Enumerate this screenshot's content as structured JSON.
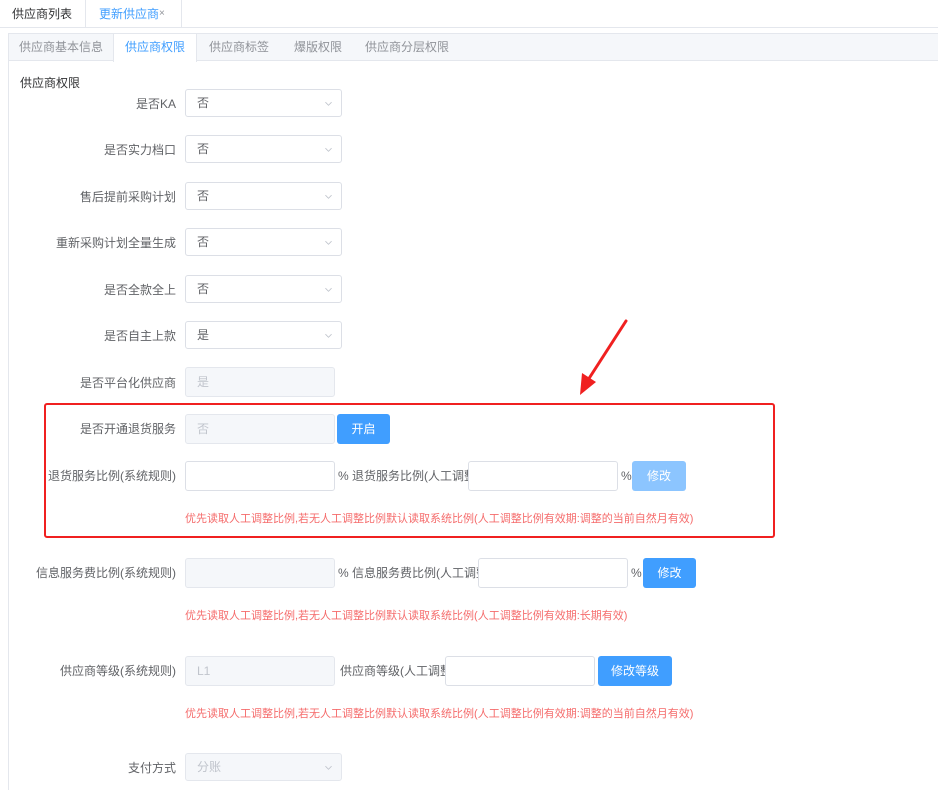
{
  "top_tabs": [
    {
      "label": "供应商列表"
    },
    {
      "label": "更新供应商",
      "close": "×"
    }
  ],
  "sub_tabs": [
    {
      "label": "供应商基本信息"
    },
    {
      "label": "供应商权限"
    },
    {
      "label": "供应商标签"
    },
    {
      "label": "爆版权限"
    },
    {
      "label": "供应商分层权限"
    }
  ],
  "section_title": "供应商权限",
  "fields": {
    "is_ka": {
      "label": "是否KA",
      "value": "否"
    },
    "is_strong_stall": {
      "label": "是否实力档口",
      "value": "否"
    },
    "after_sale_plan": {
      "label": "售后提前采购计划",
      "value": "否"
    },
    "regen_plan": {
      "label": "重新采购计划全量生成",
      "value": "否"
    },
    "full_payment": {
      "label": "是否全款全上",
      "value": "否"
    },
    "self_listing": {
      "label": "是否自主上款",
      "value": "是"
    },
    "platform_supplier": {
      "label": "是否平台化供应商",
      "value": "是"
    },
    "return_service": {
      "label": "是否开通退货服务",
      "value": "否",
      "button": "开启"
    },
    "return_ratio": {
      "label": "退货服务比例(系统规则)",
      "value": "",
      "unit": "%",
      "manual_label": "退货服务比例(人工调整)",
      "manual_value": "",
      "manual_unit": "%",
      "button": "修改",
      "note": "优先读取人工调整比例,若无人工调整比例默认读取系统比例(人工调整比例有效期:调整的当前自然月有效)"
    },
    "info_fee_ratio": {
      "label": "信息服务费比例(系统规则)",
      "value": "",
      "unit": "%",
      "manual_label": "信息服务费比例(人工调整)",
      "manual_value": "",
      "manual_unit": "%",
      "button": "修改",
      "note": "优先读取人工调整比例,若无人工调整比例默认读取系统比例(人工调整比例有效期:长期有效)"
    },
    "supplier_level": {
      "label": "供应商等级(系统规则)",
      "value": "L1",
      "manual_label": "供应商等级(人工调整)",
      "manual_value": "",
      "button": "修改等级",
      "note": "优先读取人工调整比例,若无人工调整比例默认读取系统比例(人工调整比例有效期:调整的当前自然月有效)"
    },
    "payment_method": {
      "label": "支付方式",
      "value": "分账"
    }
  },
  "colors": {
    "primary": "#409eff",
    "danger": "#f56c6c",
    "highlight": "#f02020"
  }
}
